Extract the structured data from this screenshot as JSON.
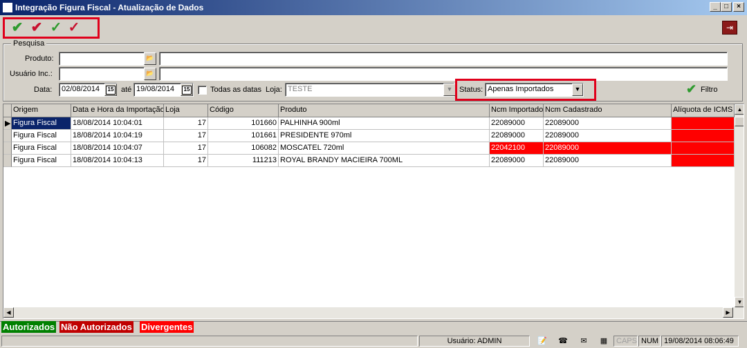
{
  "window": {
    "title": "Integração Figura Fiscal - Atualização de Dados"
  },
  "toolbar": {
    "check_colors": [
      "#2e9a2e",
      "#c8102e",
      "#2e9a2e",
      "#c8102e"
    ]
  },
  "search": {
    "group_label": "Pesquisa",
    "produto_label": "Produto:",
    "usuario_label": "Usuário Inc.:",
    "data_label": "Data:",
    "date_from": "02/08/2014",
    "ate_label": "até",
    "date_to": "19/08/2014",
    "todas_label": "Todas as datas",
    "loja_label": "Loja:",
    "loja_value": "TESTE",
    "status_label": "Status:",
    "status_value": "Apenas Importados",
    "filter_label": "Filtro"
  },
  "grid": {
    "columns": [
      "Origem",
      "Data e Hora da Importação",
      "Loja",
      "Código",
      "Produto",
      "Ncm Importado",
      "Ncm Cadastrado",
      "Alíquota de ICMS"
    ],
    "rows": [
      {
        "origem": "Figura Fiscal",
        "datahora": "18/08/2014 10:04:01",
        "loja": "17",
        "codigo": "101660",
        "produto": "PALHINHA 900ml",
        "ncm_imp": "22089000",
        "ncm_cad": "22089000"
      },
      {
        "origem": "Figura Fiscal",
        "datahora": "18/08/2014 10:04:19",
        "loja": "17",
        "codigo": "101661",
        "produto": "PRESIDENTE 970ml",
        "ncm_imp": "22089000",
        "ncm_cad": "22089000"
      },
      {
        "origem": "Figura Fiscal",
        "datahora": "18/08/2014 10:04:07",
        "loja": "17",
        "codigo": "106082",
        "produto": "MOSCATEL 720ml",
        "ncm_imp": "22042100",
        "ncm_cad": "22089000"
      },
      {
        "origem": "Figura Fiscal",
        "datahora": "18/08/2014 10:04:13",
        "loja": "17",
        "codigo": "111213",
        "produto": "ROYAL BRANDY MACIEIRA 700ML",
        "ncm_imp": "22089000",
        "ncm_cad": "22089000"
      }
    ]
  },
  "legend": {
    "autorizados": "Autorizados",
    "nao_autorizados": "Não Autorizados",
    "divergentes": "Divergentes",
    "colors": {
      "autorizados": "#008000",
      "nao_autorizados": "#c00000",
      "divergentes": "#ff0000"
    }
  },
  "statusbar": {
    "usuario": "Usuário: ADMIN",
    "caps": "CAPS",
    "num": "NUM",
    "datetime": "19/08/2014 08:06:49"
  }
}
